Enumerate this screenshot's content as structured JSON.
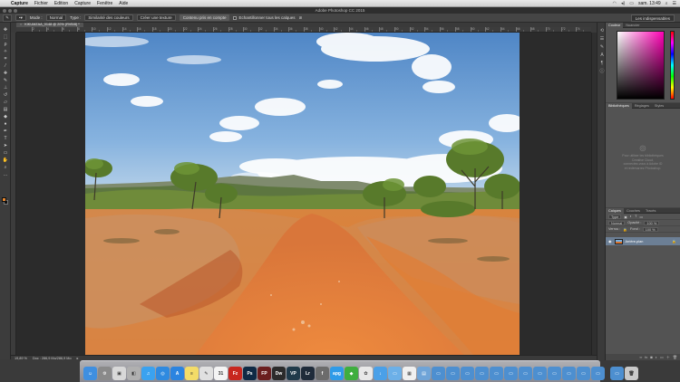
{
  "menubar": {
    "apple": "",
    "items": [
      "Capture",
      "Fichier",
      "Edition",
      "Capture",
      "Fenêtre",
      "Aide"
    ],
    "clock": "sam. 13:49"
  },
  "window": {
    "title": "Adobe Photoshop CC 2015"
  },
  "options": {
    "mode_label": "Mode :",
    "mode_value": "Normal",
    "type_label": "Type :",
    "btn1": "Similarité des couleurs",
    "btn2": "Créer une texture",
    "btn3": "Contenu pris en compte",
    "sample_all": "Echantillonner tous les calques",
    "workspace": "Les indispensables"
  },
  "document": {
    "tab": "KIKUMZAA_0148 @ 20% (RVB/8) *",
    "status_zoom": "19,89 %",
    "status_doc": "Doc : 286,9 Mo/286,9 Mo"
  },
  "ruler": {
    "labels": [
      "2",
      "4",
      "6",
      "8",
      "10",
      "12",
      "14",
      "16",
      "18",
      "20",
      "22",
      "24",
      "26",
      "28",
      "30",
      "32",
      "34",
      "36",
      "38",
      "40",
      "42",
      "44",
      "46",
      "48",
      "50",
      "52",
      "54",
      "56",
      "58",
      "60",
      "62",
      "64",
      "66",
      "68",
      "70",
      "72",
      "74"
    ]
  },
  "panels": {
    "color_tabs": [
      "Couleur",
      "Nuancier"
    ],
    "lib_tabs": [
      "Bibliothèques",
      "Réglages",
      "Styles"
    ],
    "lib_message": [
      "Pour utiliser les bibliothèques",
      "Creative Cloud,",
      "connectez-vous à Adobe ID",
      "et redémarrez Photoshop."
    ],
    "layer_tabs": [
      "Calques",
      "Couches",
      "Tracés"
    ],
    "layer_filter": "Type",
    "layer_blend": "Normal",
    "opacity_label": "Opacité :",
    "opacity_value": "100 %",
    "lock_label": "Verrou :",
    "fill_label": "Fond :",
    "fill_value": "100 %",
    "background_layer": "Arrière-plan"
  },
  "colors": {
    "foreground": "#e8882f",
    "background": "#111111",
    "selected_layer": "#6c7f95"
  },
  "dock": {
    "icons": [
      {
        "name": "finder-icon",
        "label": "☺",
        "color": "#3f8fe0"
      },
      {
        "name": "system-preferences-icon",
        "label": "⚙",
        "color": "#8a8a8a"
      },
      {
        "name": "preview-icon",
        "label": "▣",
        "color": "#d8d8d8"
      },
      {
        "name": "image-capture-icon",
        "label": "◧",
        "color": "#b0b0b0"
      },
      {
        "name": "itunes-icon",
        "label": "♫",
        "color": "#3aa2f0"
      },
      {
        "name": "safari-icon",
        "label": "◎",
        "color": "#2f8ae0"
      },
      {
        "name": "app-store-icon",
        "label": "A",
        "color": "#2b84e0"
      },
      {
        "name": "notes-icon",
        "label": "≡",
        "color": "#f3dc68"
      },
      {
        "name": "textedit-icon",
        "label": "✎",
        "color": "#e0e0e0"
      },
      {
        "name": "calendar-icon",
        "label": "31",
        "color": "#f4f4f4"
      },
      {
        "name": "filezilla-icon",
        "label": "Fz",
        "color": "#c8271f"
      },
      {
        "name": "photoshop-icon",
        "label": "Ps",
        "color": "#0f2a45"
      },
      {
        "name": "framemaker-icon",
        "label": "FP",
        "color": "#6b1f1f"
      },
      {
        "name": "davinci-icon",
        "label": "Dw",
        "color": "#2b2b2b"
      },
      {
        "name": "vp-icon",
        "label": "VP",
        "color": "#203a4a"
      },
      {
        "name": "lightroom-icon",
        "label": "Lr",
        "color": "#1f2b3a"
      },
      {
        "name": "font-icon",
        "label": "f",
        "color": "#6c6c6c"
      },
      {
        "name": "apple-pay-icon",
        "label": "apg",
        "color": "#2f9be8"
      },
      {
        "name": "evernote-icon",
        "label": "◆",
        "color": "#3fae3f"
      },
      {
        "name": "photos-icon",
        "label": "✿",
        "color": "#e8e8e8"
      },
      {
        "name": "downloads-icon",
        "label": "↓",
        "color": "#4aa0e8"
      },
      {
        "name": "folder-icon",
        "label": "▭",
        "color": "#6cb0e8"
      },
      {
        "name": "grid-icon",
        "label": "▦",
        "color": "#f0f0f0"
      },
      {
        "name": "stack-icon",
        "label": "▤",
        "color": "#6fa4d8"
      },
      {
        "name": "window-1-icon",
        "label": "▭",
        "color": "#4d8fd0"
      },
      {
        "name": "window-2-icon",
        "label": "▭",
        "color": "#4d8fd0"
      },
      {
        "name": "window-3-icon",
        "label": "▭",
        "color": "#4d8fd0"
      },
      {
        "name": "window-4-icon",
        "label": "▭",
        "color": "#4d8fd0"
      },
      {
        "name": "window-5-icon",
        "label": "▭",
        "color": "#4d8fd0"
      },
      {
        "name": "window-6-icon",
        "label": "▭",
        "color": "#4d8fd0"
      },
      {
        "name": "window-7-icon",
        "label": "▭",
        "color": "#4d8fd0"
      },
      {
        "name": "window-8-icon",
        "label": "▭",
        "color": "#4d8fd0"
      },
      {
        "name": "window-9-icon",
        "label": "▭",
        "color": "#4d8fd0"
      },
      {
        "name": "window-10-icon",
        "label": "▭",
        "color": "#4d8fd0"
      },
      {
        "name": "window-11-icon",
        "label": "▭",
        "color": "#4d8fd0"
      },
      {
        "name": "window-12-icon",
        "label": "▭",
        "color": "#4d8fd0"
      },
      {
        "name": "window-13-icon",
        "label": "▭",
        "color": "#4d8fd0"
      },
      {
        "name": "trash-icon",
        "label": "🗑",
        "color": "#c9c9c9"
      }
    ]
  }
}
